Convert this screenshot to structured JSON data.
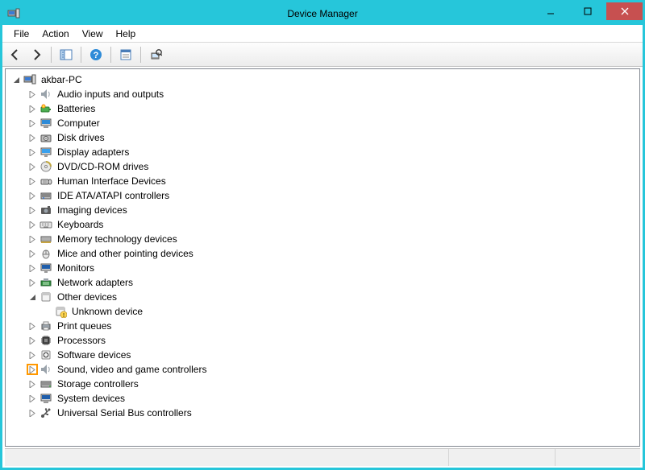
{
  "window": {
    "title": "Device Manager"
  },
  "menu": {
    "file": "File",
    "action": "Action",
    "view": "View",
    "help": "Help"
  },
  "root": {
    "label": "akbar-PC"
  },
  "nodes": {
    "audio": {
      "label": "Audio inputs and outputs"
    },
    "batteries": {
      "label": "Batteries"
    },
    "computer": {
      "label": "Computer"
    },
    "disk": {
      "label": "Disk drives"
    },
    "display": {
      "label": "Display adapters"
    },
    "dvd": {
      "label": "DVD/CD-ROM drives"
    },
    "hid": {
      "label": "Human Interface Devices"
    },
    "ide": {
      "label": "IDE ATA/ATAPI controllers"
    },
    "imaging": {
      "label": "Imaging devices"
    },
    "keyboards": {
      "label": "Keyboards"
    },
    "memtech": {
      "label": "Memory technology devices"
    },
    "mice": {
      "label": "Mice and other pointing devices"
    },
    "monitors": {
      "label": "Monitors"
    },
    "network": {
      "label": "Network adapters"
    },
    "other": {
      "label": "Other devices"
    },
    "unknown": {
      "label": "Unknown device"
    },
    "printq": {
      "label": "Print queues"
    },
    "processors": {
      "label": "Processors"
    },
    "software": {
      "label": "Software devices"
    },
    "sound": {
      "label": "Sound, video and game controllers"
    },
    "storage": {
      "label": "Storage controllers"
    },
    "system": {
      "label": "System devices"
    },
    "usb": {
      "label": "Universal Serial Bus controllers"
    }
  }
}
